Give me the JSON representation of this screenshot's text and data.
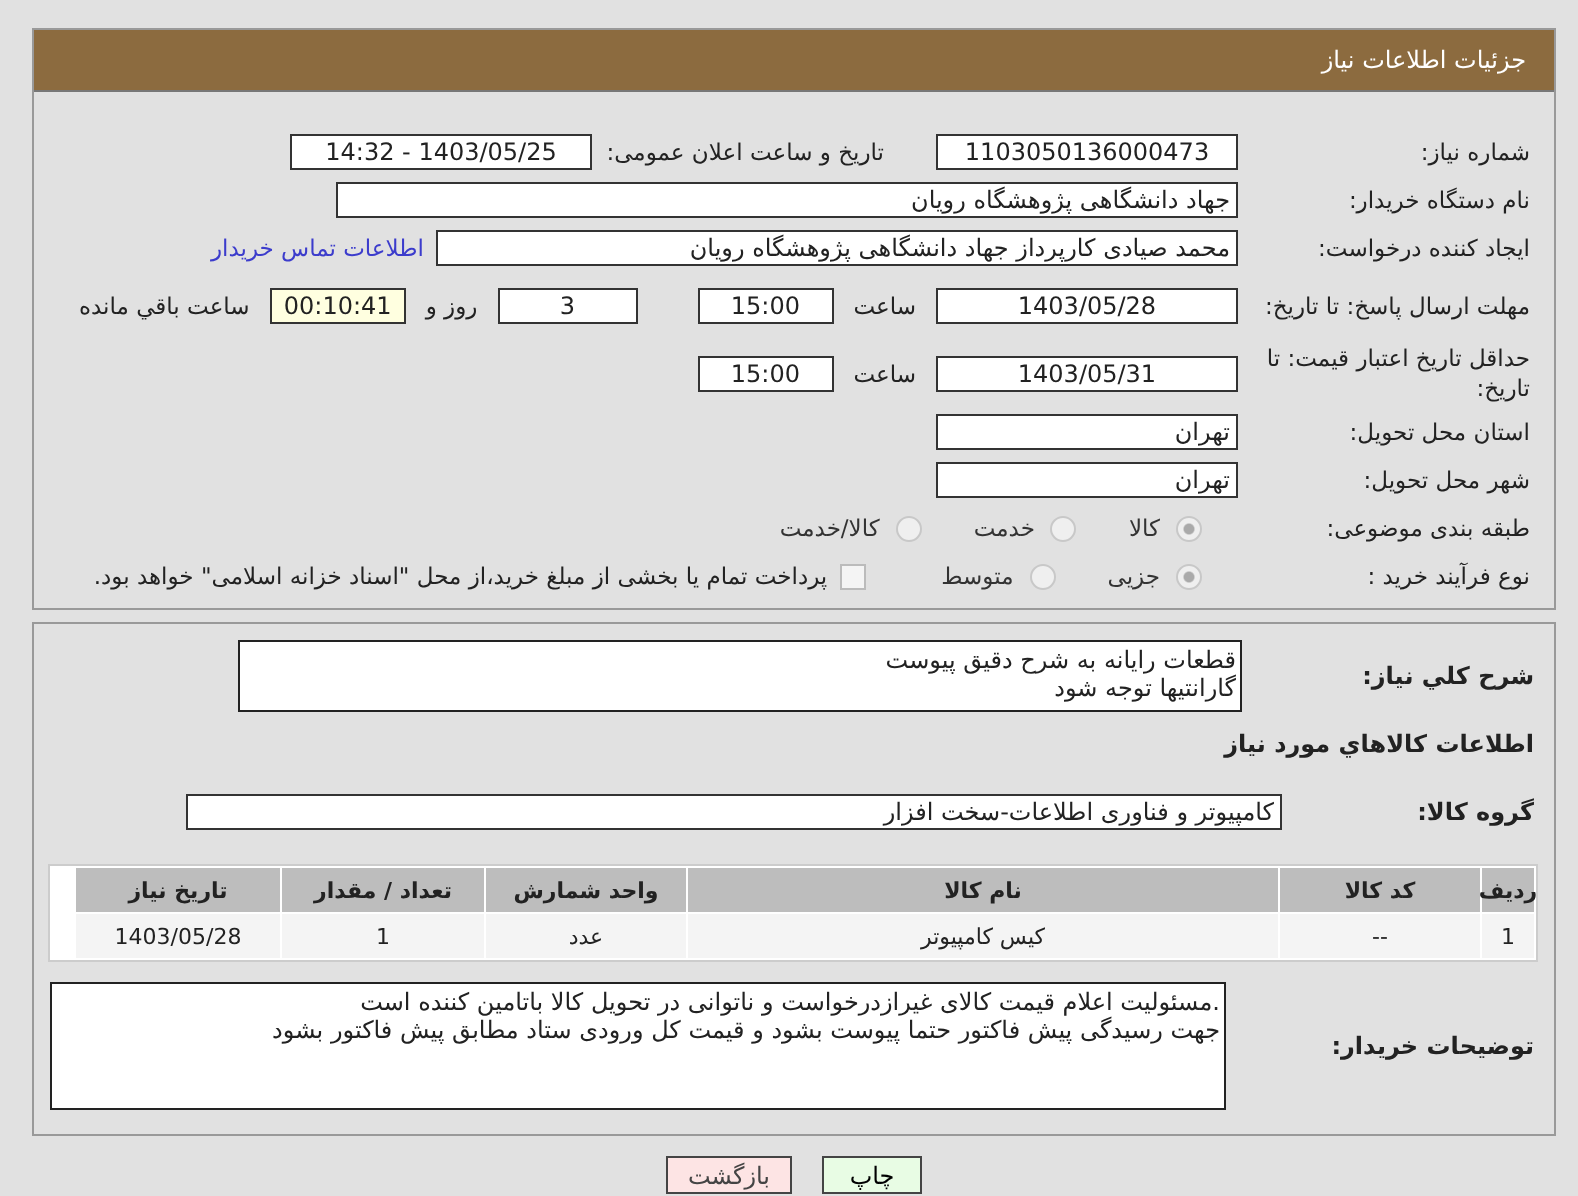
{
  "header": {
    "title": "جزئیات اطلاعات نیاز"
  },
  "need_number": {
    "label": "شماره نیاز:",
    "value": "1103050136000473"
  },
  "announcement": {
    "label": "تاریخ و ساعت اعلان عمومی:",
    "value": "1403/05/25 - 14:32"
  },
  "buyer_org": {
    "label": "نام دستگاه خریدار:",
    "value": "جهاد دانشگاهی پژوهشگاه رویان"
  },
  "requester": {
    "label": "ایجاد کننده درخواست:",
    "value": "محمد صیادی کارپرداز جهاد دانشگاهی پژوهشگاه رویان",
    "link": "اطلاعات تماس خریدار"
  },
  "deadline": {
    "label": "مهلت ارسال پاسخ: تا تاریخ:",
    "date": "1403/05/28",
    "time_label": "ساعت",
    "time": "15:00",
    "days": "3",
    "days_label": "روز و",
    "remaining": "00:10:41",
    "remaining_label": "ساعت باقي مانده"
  },
  "validity": {
    "label": "حداقل تاریخ اعتبار قیمت: تا تاریخ:",
    "date": "1403/05/31",
    "time_label": "ساعت",
    "time": "15:00"
  },
  "province": {
    "label": "استان محل تحویل:",
    "value": "تهران"
  },
  "city": {
    "label": "شهر محل تحویل:",
    "value": "تهران"
  },
  "category": {
    "label": "طبقه بندی موضوعی:",
    "options": [
      {
        "label": "کالا",
        "selected": true
      },
      {
        "label": "خدمت",
        "selected": false
      },
      {
        "label": "کالا/خدمت",
        "selected": false
      }
    ]
  },
  "purchase_type": {
    "label": "نوع فرآیند خرید :",
    "options": [
      {
        "label": "جزیی",
        "selected": true
      },
      {
        "label": "متوسط",
        "selected": false
      }
    ],
    "payment": {
      "checked": false,
      "label": "پرداخت تمام یا بخشی از مبلغ خرید،از محل \"اسناد خزانه اسلامی\" خواهد بود."
    }
  },
  "description": {
    "label": "شرح کلي نياز:",
    "lines": [
      "قطعات رایانه به شرح دقیق پیوست",
      "گارانتیها توجه شود"
    ]
  },
  "goods_title": "اطلاعات کالاهاي مورد نياز",
  "goods_group": {
    "label": "گروه کالا:",
    "value": "کامپیوتر و فناوری اطلاعات-سخت افزار"
  },
  "table": {
    "columns": [
      "رديف",
      "کد کالا",
      "نام کالا",
      "واحد شمارش",
      "تعداد / مقدار",
      "تاريخ نياز"
    ],
    "rows": [
      [
        "1",
        "--",
        "کیس کامپیوتر",
        "عدد",
        "1",
        "1403/05/28"
      ]
    ]
  },
  "buyer_notes": {
    "label": "توضیحات خریدار:",
    "lines": [
      ".مسئولیت اعلام قیمت کالای غیرازدرخواست و ناتوانی در تحویل کالا باتامین کننده است",
      "جهت رسیدگی پیش فاکتور حتما پیوست بشود و قیمت کل ورودی ستاد مطابق پیش فاکتور بشود"
    ]
  },
  "buttons": [
    {
      "label": "چاپ",
      "kind": "print"
    },
    {
      "label": "بازگشت",
      "kind": "back"
    }
  ]
}
